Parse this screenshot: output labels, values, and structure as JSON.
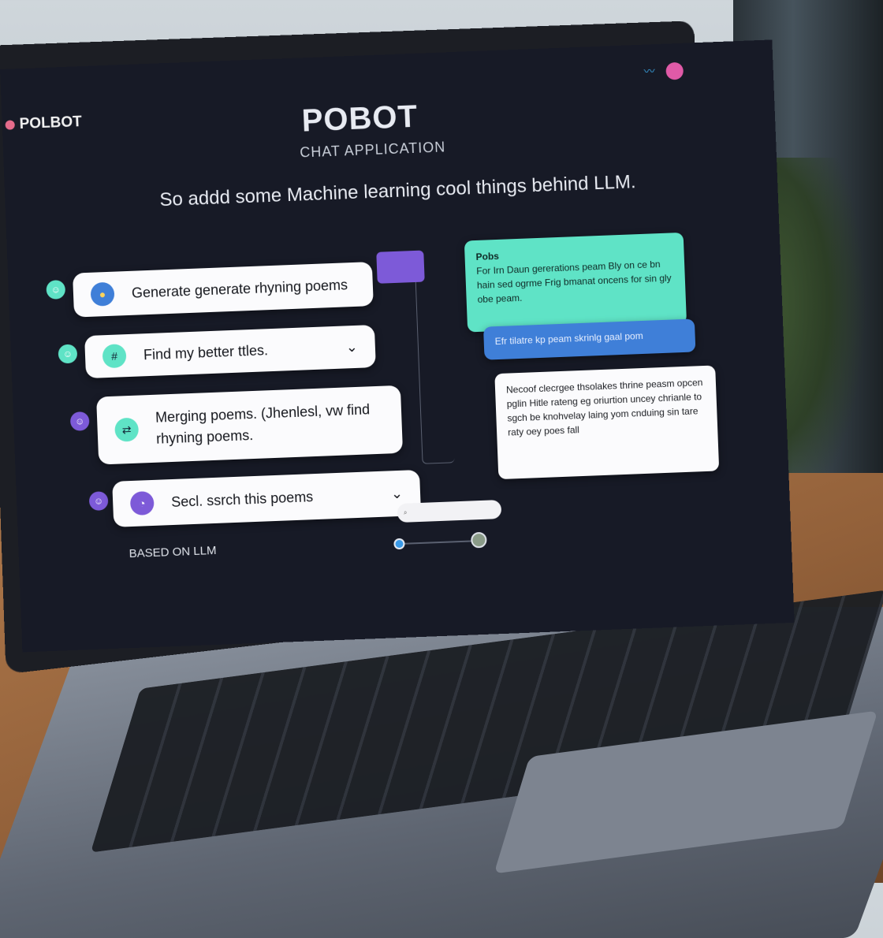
{
  "app": {
    "logo_text": "POLBOT",
    "title": "POBOT",
    "subtitle": "CHAT APPLICATION",
    "headline": "So addd some Machine learning cool things behind LLM.",
    "footer": "BASED ON LLM"
  },
  "commands": [
    {
      "label": "Generate generate rhyning poems",
      "icon": "emoji-icon"
    },
    {
      "label": "Find my better ttles.",
      "icon": "hash-icon"
    },
    {
      "label": "Merging poems. (Jhenlesl, vw find rhyning poems.",
      "icon": "merge-icon"
    },
    {
      "label": "Secl. ssrch this poems",
      "icon": "search-icon"
    }
  ],
  "responses": [
    {
      "title": "Pobs",
      "text": "For Irn Daun gererations peam Bly on ce bn hain sed ogrme Frig bmanat oncens for sin gly obe peam.",
      "color": "#5fe3c6"
    },
    {
      "text": "Efr tilatre kp peam skrinlg gaal pom",
      "color": "#3f7fd8"
    },
    {
      "text": "Necoof clecrgee thsolakes thrine peasm opcen pglin Hitle rateng eg oriurtion uncey chrianle to sgch be knohvelay laing yom cnduing sin tare raty oey poes fall",
      "color": "#fbfbfd"
    }
  ],
  "colors": {
    "accent_teal": "#5fe3c6",
    "accent_blue": "#3f7fd8",
    "accent_purple": "#7d5ad8",
    "background": "#171a26"
  }
}
